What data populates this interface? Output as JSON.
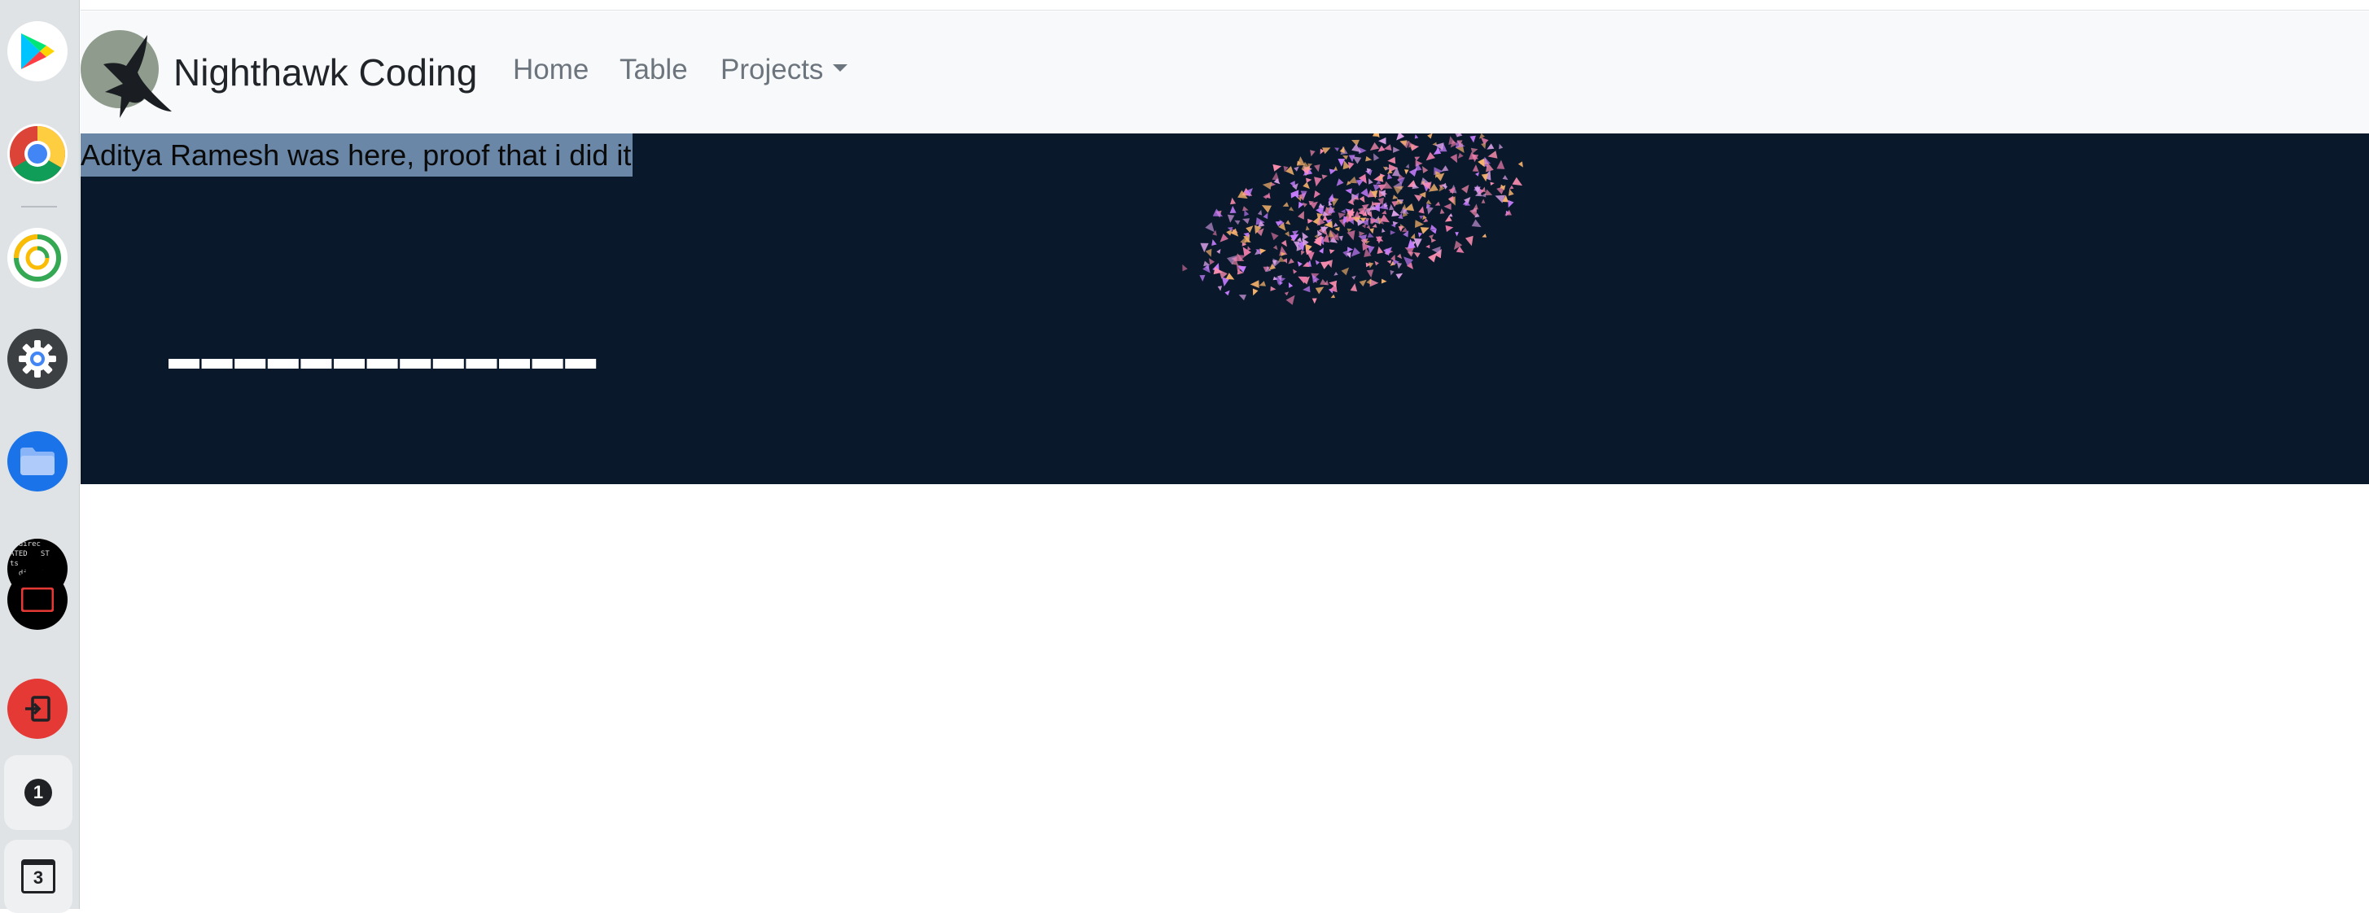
{
  "shelf": {
    "apps": [
      {
        "name": "play-store"
      },
      {
        "name": "chrome"
      },
      {
        "name": "tracker"
      },
      {
        "name": "settings"
      },
      {
        "name": "files"
      },
      {
        "name": "terminal"
      },
      {
        "name": "exit-app"
      }
    ],
    "desk1_label": "1",
    "desk3_label": "3",
    "terminal_text": "  direc\nATED   ST\nts\n  direc*\n"
  },
  "navbar": {
    "brand": "Nighthawk Coding",
    "links": {
      "home": "Home",
      "table": "Table",
      "projects": "Projects"
    }
  },
  "banner": {
    "selected_text": "Aditya Ramesh was here, proof that i did it",
    "background_color": "#0a182c",
    "particle_colors": [
      "#e87aa8",
      "#f5b26b",
      "#d9a0e6",
      "#ff8fb1",
      "#c77dff"
    ]
  }
}
